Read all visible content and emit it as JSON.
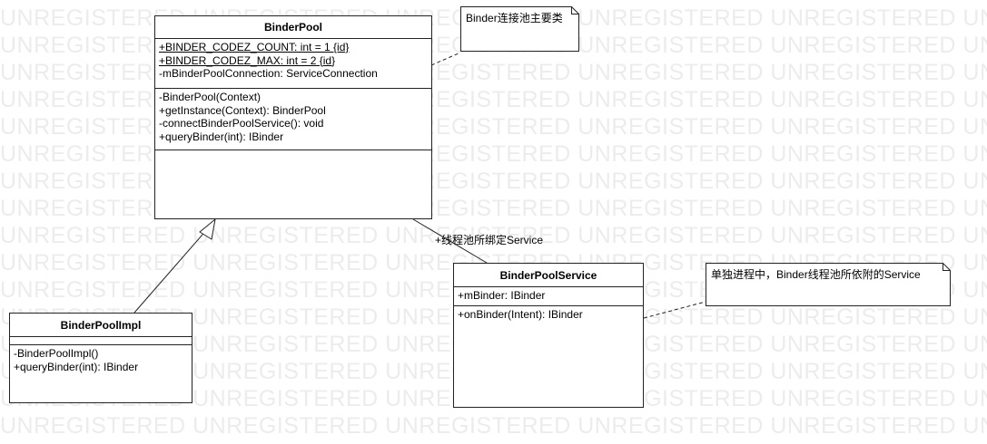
{
  "watermark_text": "UNREGISTERED UNREGISTERED UNREGISTERED UNREGISTERED UNREGISTERED UNREGISTERED",
  "classes": {
    "binder_pool": {
      "name": "BinderPool",
      "attributes": [
        {
          "text": "+BINDER_CODEZ_COUNT: int = 1 {id}",
          "static": true
        },
        {
          "text": "+BINDER_CODEZ_MAX: int = 2 {id}",
          "static": true
        },
        {
          "text": "-mBinderPoolConnection: ServiceConnection",
          "static": false
        }
      ],
      "operations": [
        "-BinderPool(Context)",
        "+getInstance(Context): BinderPool",
        "-connectBinderPoolService(): void",
        "+queryBinder(int): IBinder"
      ]
    },
    "binder_pool_impl": {
      "name": "BinderPoolImpl",
      "attributes": [],
      "operations": [
        "-BinderPoolImpl()",
        "+queryBinder(int): IBinder"
      ]
    },
    "binder_pool_service": {
      "name": "BinderPoolService",
      "attributes": [
        {
          "text": "+mBinder: IBinder",
          "static": false
        }
      ],
      "operations": [
        "+onBinder(Intent): IBinder"
      ]
    }
  },
  "notes": {
    "binder_pool_note": "Binder连接池主要类",
    "service_note": "单独进程中，Binder线程池所依附的Service"
  },
  "associations": {
    "pool_service_label": "+线程池所绑定Service"
  }
}
